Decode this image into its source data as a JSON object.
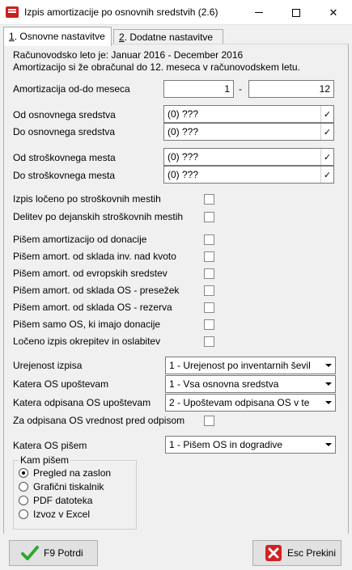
{
  "window": {
    "title": "Izpis amortizacije po osnovnih sredstvih  (2.6)",
    "minimize_glyph": "",
    "close_glyph": "✕"
  },
  "tabs": [
    {
      "num": "1",
      "label": ". Osnovne nastavitve"
    },
    {
      "num": "2",
      "label": ". Dodatne nastavitve"
    }
  ],
  "info": {
    "line1": "Računovodsko leto je: Januar 2016 - December 2016",
    "line2": "Amortizacijo si že obračunal do 12. meseca v računovodskem letu."
  },
  "period": {
    "label": "Amortizacija od-do meseca",
    "from": "1",
    "separator": "-",
    "to": "12"
  },
  "asset_from": {
    "label": "Od osnovnega sredstva",
    "value": "(0) ???"
  },
  "asset_to": {
    "label": "Do osnovnega sredstva",
    "value": "(0) ???"
  },
  "cost_from": {
    "label": "Od stroškovnega mesta",
    "value": "(0) ???"
  },
  "cost_to": {
    "label": "Do stroškovnega mesta",
    "value": "(0) ???"
  },
  "lookup_glyph": "✓",
  "checkboxes": [
    "Izpis ločeno po stroškovnih mestih",
    "Delitev po dejanskih stroškovnih mestih",
    "Pišem amortizacijo od donacije",
    "Pišem amort. od sklada inv. nad kvoto",
    "Pišem amort. od evropskih sredstev",
    "Pišem amort. od sklada OS - presežek",
    "Pišem amort. od sklada OS - rezerva",
    "Pišem samo OS, ki imajo donacije",
    "Ločeno izpis okrepitev in oslabitev"
  ],
  "combos": {
    "sort": {
      "label": "Urejenost izpisa",
      "value": "1 - Urejenost po inventarnih ševil"
    },
    "which": {
      "label": "Katera OS upoštevam",
      "value": "1 - Vsa osnovna sredstva"
    },
    "written_off": {
      "label": "Katera odpisana OS upoštevam",
      "value": "2 - Upoštevam odpisana OS v te"
    },
    "write_label": {
      "label": "Katera OS pišem",
      "value": "1 - Pišem OS in dogradive"
    }
  },
  "written_off_value_check": "Za odpisana OS vrednost pred odpisom",
  "output": {
    "title": "Kam pišem",
    "options": [
      "Pregled na zaslon",
      "Grafični tiskalnik",
      "PDF datoteka",
      "Izvoz v Excel"
    ],
    "selected": 0
  },
  "buttons": {
    "ok": "F9 Potrdi",
    "cancel": "Esc Prekini"
  },
  "colors": {
    "ok_icon": "#2ea82e",
    "cancel_icon": "#d42020"
  }
}
